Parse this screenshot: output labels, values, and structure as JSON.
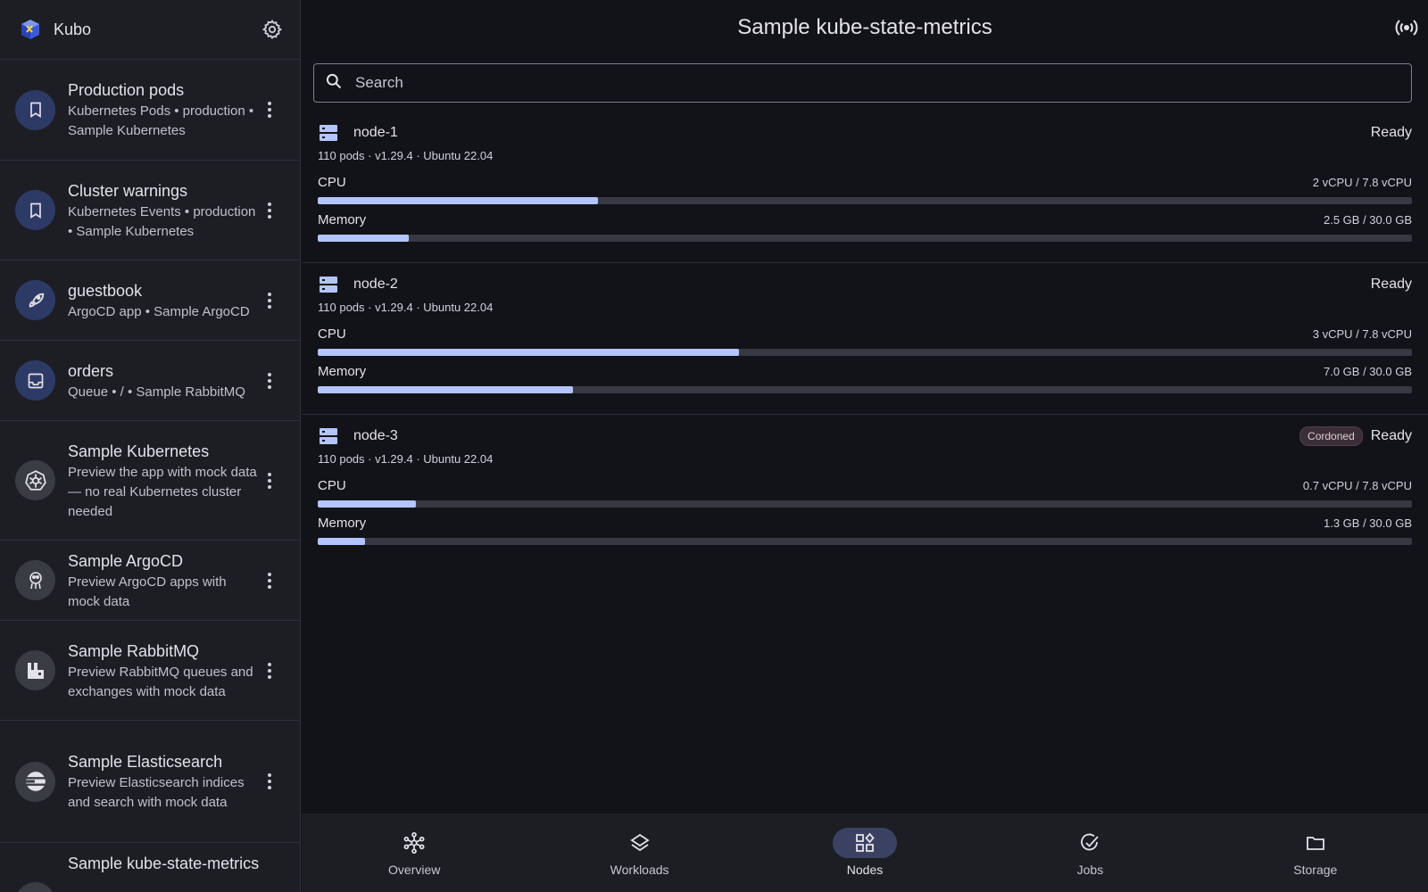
{
  "app": {
    "name": "Kubo"
  },
  "sidebar": {
    "items": [
      {
        "title": "Production pods",
        "subtitle": "Kubernetes Pods • production • Sample Kubernetes",
        "icon": "bookmark-icon"
      },
      {
        "title": "Cluster warnings",
        "subtitle": "Kubernetes Events • production • Sample Kubernetes",
        "icon": "bookmark-icon"
      },
      {
        "title": "guestbook",
        "subtitle": "ArgoCD app • Sample ArgoCD",
        "icon": "rocket-icon"
      },
      {
        "title": "orders",
        "subtitle": "Queue • / • Sample RabbitMQ",
        "icon": "inbox-icon"
      },
      {
        "title": "Sample Kubernetes",
        "subtitle": "Preview the app with mock data — no real Kubernetes cluster needed",
        "icon": "kubernetes-icon"
      },
      {
        "title": "Sample ArgoCD",
        "subtitle": "Preview ArgoCD apps with mock data",
        "icon": "argocd-icon"
      },
      {
        "title": "Sample RabbitMQ",
        "subtitle": "Preview RabbitMQ queues and exchanges with mock data",
        "icon": "rabbitmq-icon"
      },
      {
        "title": "Sample Elasticsearch",
        "subtitle": "Preview Elasticsearch indices and search with mock data",
        "icon": "elasticsearch-icon"
      },
      {
        "title": "Sample kube-state-metrics",
        "subtitle": "",
        "icon": "metrics-icon"
      }
    ]
  },
  "header": {
    "title": "Sample kube-state-metrics"
  },
  "search": {
    "placeholder": "Search"
  },
  "nodes": [
    {
      "name": "node-1",
      "status": "Ready",
      "badge": "",
      "meta": "110 pods · v1.29.4 · Ubuntu 22.04",
      "cpu": {
        "label": "CPU",
        "value": "2 vCPU / 7.8 vCPU",
        "fraction": 0.256
      },
      "memory": {
        "label": "Memory",
        "value": "2.5 GB / 30.0 GB",
        "fraction": 0.083
      }
    },
    {
      "name": "node-2",
      "status": "Ready",
      "badge": "",
      "meta": "110 pods · v1.29.4 · Ubuntu 22.04",
      "cpu": {
        "label": "CPU",
        "value": "3 vCPU / 7.8 vCPU",
        "fraction": 0.385
      },
      "memory": {
        "label": "Memory",
        "value": "7.0 GB / 30.0 GB",
        "fraction": 0.233
      }
    },
    {
      "name": "node-3",
      "status": "Ready",
      "badge": "Cordoned",
      "meta": "110 pods · v1.29.4 · Ubuntu 22.04",
      "cpu": {
        "label": "CPU",
        "value": "0.7 vCPU / 7.8 vCPU",
        "fraction": 0.09
      },
      "memory": {
        "label": "Memory",
        "value": "1.3 GB / 30.0 GB",
        "fraction": 0.043
      }
    }
  ],
  "bottom_nav": {
    "items": [
      {
        "label": "Overview",
        "icon": "network-icon",
        "active": false
      },
      {
        "label": "Workloads",
        "icon": "layers-icon",
        "active": false
      },
      {
        "label": "Nodes",
        "icon": "grid-icon",
        "active": true
      },
      {
        "label": "Jobs",
        "icon": "check-circle-icon",
        "active": false
      },
      {
        "label": "Storage",
        "icon": "folder-icon",
        "active": false
      }
    ]
  },
  "colors": {
    "accent": "#b4c4ff",
    "background": "#121318",
    "surface": "#1c1e24"
  }
}
